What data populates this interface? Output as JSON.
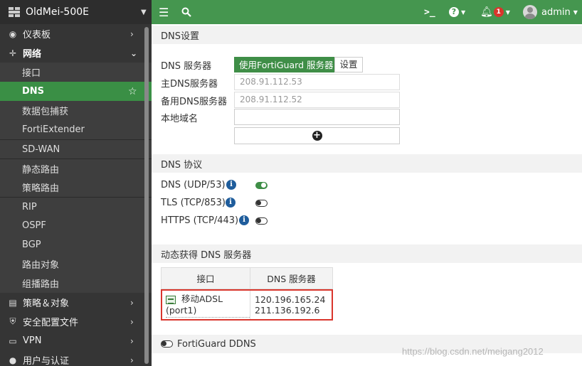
{
  "brand": {
    "device_name": "OldMei-500E"
  },
  "sidebar": {
    "items": [
      {
        "label": "仪表板",
        "icon": "dashboard-icon"
      },
      {
        "label": "网络",
        "icon": "network-icon"
      },
      {
        "label": "接口"
      },
      {
        "label": "DNS"
      },
      {
        "label": "数据包捕获"
      },
      {
        "label": "FortiExtender"
      },
      {
        "label": "SD-WAN"
      },
      {
        "label": "静态路由"
      },
      {
        "label": "策略路由"
      },
      {
        "label": "RIP"
      },
      {
        "label": "OSPF"
      },
      {
        "label": "BGP"
      },
      {
        "label": "路由对象"
      },
      {
        "label": "组播路由"
      },
      {
        "label": "策略＆对象",
        "icon": "policy-icon"
      },
      {
        "label": "安全配置文件",
        "icon": "shield-icon"
      },
      {
        "label": "VPN",
        "icon": "vpn-icon"
      },
      {
        "label": "用户与认证",
        "icon": "user-icon"
      }
    ]
  },
  "topbar": {
    "notification_count": "1",
    "user": "admin"
  },
  "dns_settings": {
    "header": "DNS设置",
    "dns_server_label": "DNS 服务器",
    "use_fortiguard_label": "使用FortiGuard 服务器",
    "custom_label": "设置",
    "primary_label": "主DNS服务器",
    "primary_value": "208.91.112.53",
    "secondary_label": "备用DNS服务器",
    "secondary_value": "208.91.112.52",
    "local_domain_label": "本地域名",
    "local_domain_value": ""
  },
  "dns_protocols": {
    "header": "DNS 协议",
    "items": [
      {
        "label": "DNS (UDP/53)",
        "enabled": true
      },
      {
        "label": "TLS (TCP/853)",
        "enabled": false
      },
      {
        "label": "HTTPS (TCP/443)",
        "enabled": false
      }
    ]
  },
  "dynamic_dns": {
    "header": "动态获得 DNS 服务器",
    "columns": [
      "接口",
      "DNS 服务器"
    ],
    "rows": [
      {
        "interface": "移动ADSL (port1)",
        "servers": [
          "120.196.165.24",
          "211.136.192.6"
        ]
      }
    ]
  },
  "fortiguard_ddns": {
    "label": "FortiGuard DDNS",
    "enabled": false
  },
  "watermark": "https://blog.csdn.net/meigang2012",
  "colors": {
    "accent_green": "#45964f",
    "sidebar_bg": "#2d2d2d",
    "highlight_red": "#d9352c"
  }
}
